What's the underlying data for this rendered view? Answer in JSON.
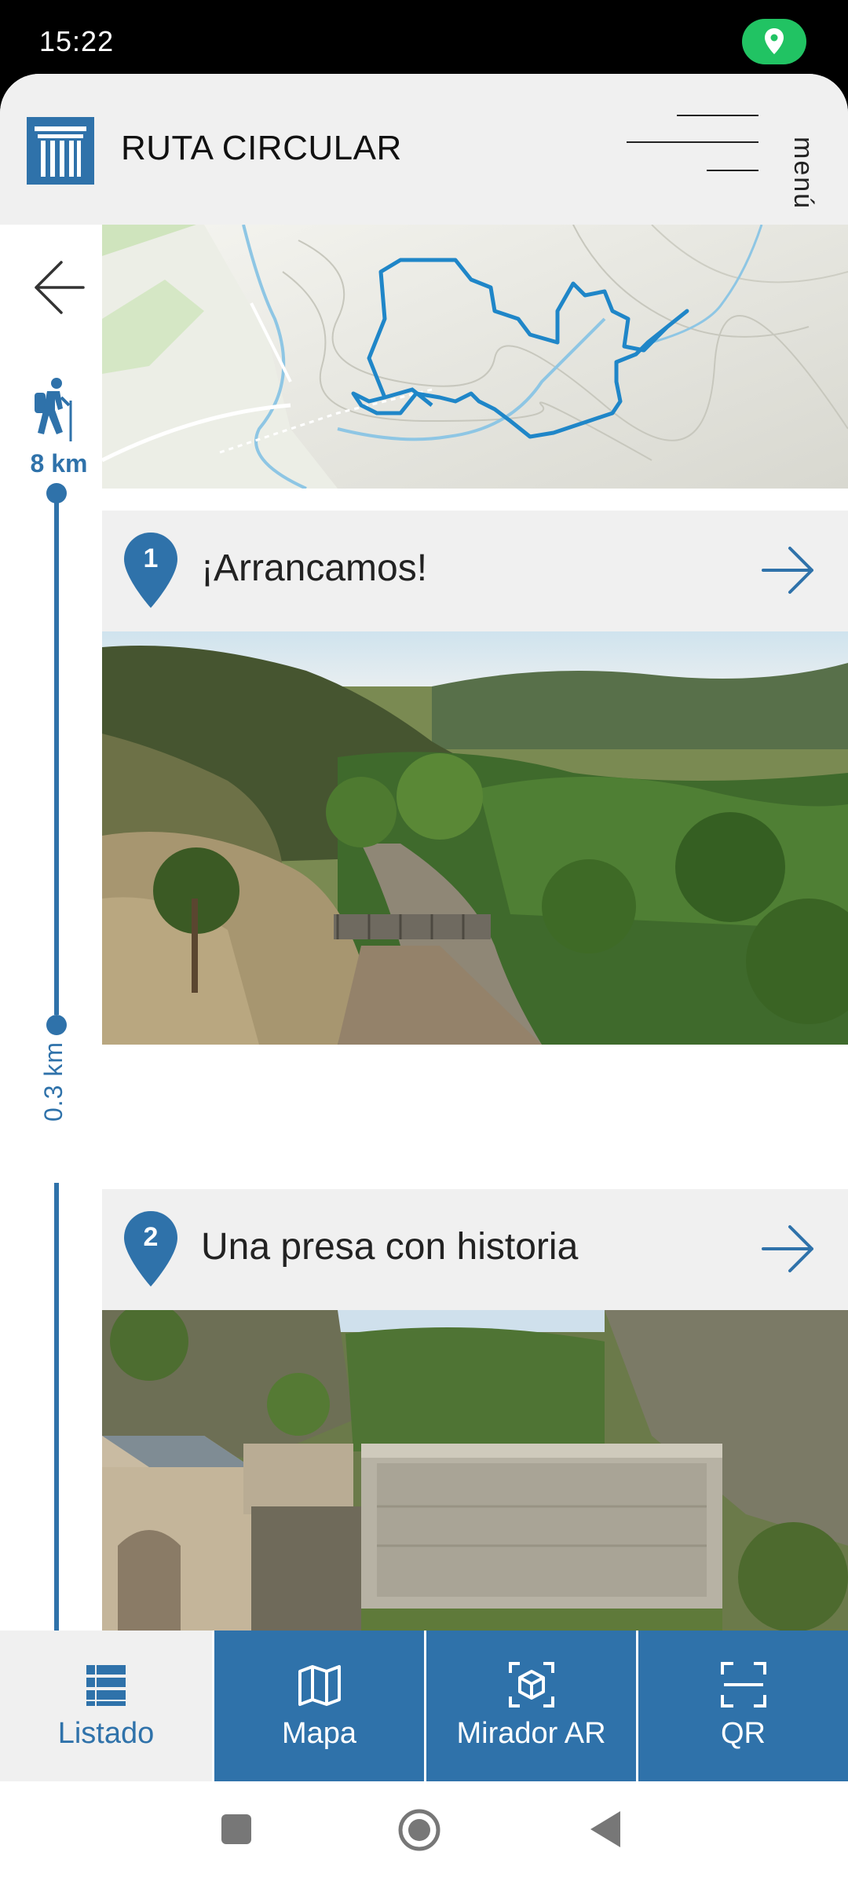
{
  "status_bar": {
    "time": "15:22"
  },
  "header": {
    "title": "RUTA CIRCULAR",
    "menu_label": "menú"
  },
  "rail": {
    "total_distance": "8 km",
    "segment_distance": "0.3 km"
  },
  "stops": [
    {
      "number": "1",
      "title": "¡Arrancamos!"
    },
    {
      "number": "2",
      "title": "Una presa con historia"
    }
  ],
  "tabs": [
    {
      "label": "Listado",
      "icon": "list-icon",
      "active": true
    },
    {
      "label": "Mapa",
      "icon": "map-icon",
      "active": false
    },
    {
      "label": "Mirador AR",
      "icon": "ar-cube-icon",
      "active": false
    },
    {
      "label": "QR",
      "icon": "qr-scan-icon",
      "active": false
    }
  ],
  "colors": {
    "accent": "#2f72aa",
    "route": "#1f86c8",
    "status_location": "#21c363",
    "panel_bg": "#f0f0f0"
  }
}
